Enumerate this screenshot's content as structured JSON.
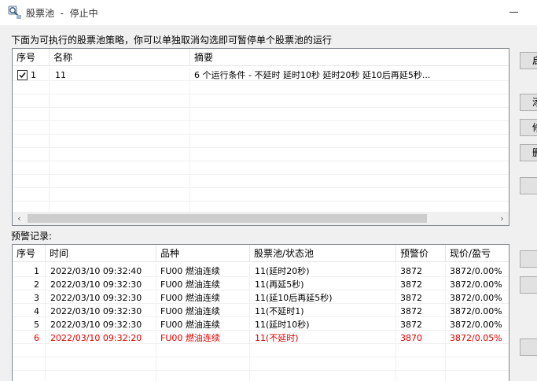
{
  "window": {
    "title": "股票池  -  停止中"
  },
  "instruction": "下面为可执行的股票池策略，你可以单独取消勾选即可暂停单个股票池的运行",
  "strategy_table": {
    "columns": [
      "序号",
      "名称",
      "摘要"
    ],
    "rows": [
      {
        "checked": true,
        "index": "1",
        "name": "11",
        "summary": "6 个运行条件 - 不延时 延时10秒 延时20秒 延10后再延5秒..."
      }
    ]
  },
  "alert_label": "预警记录:",
  "alert_table": {
    "columns": [
      "序号",
      "时间",
      "品种",
      "股票池/状态池",
      "预警价",
      "现价/盈亏"
    ],
    "rows": [
      {
        "index": "1",
        "time": "2022/03/10 09:32:40",
        "symbol": "FU00 燃油连续",
        "pool": "11(延时20秒)",
        "alert_price": "3872",
        "price_pnl": "3872/0.00%",
        "highlight": false
      },
      {
        "index": "2",
        "time": "2022/03/10 09:32:30",
        "symbol": "FU00 燃油连续",
        "pool": "11(再延5秒)",
        "alert_price": "3872",
        "price_pnl": "3872/0.00%",
        "highlight": false
      },
      {
        "index": "3",
        "time": "2022/03/10 09:32:30",
        "symbol": "FU00 燃油连续",
        "pool": "11(延10后再延5秒)",
        "alert_price": "3872",
        "price_pnl": "3872/0.00%",
        "highlight": false
      },
      {
        "index": "4",
        "time": "2022/03/10 09:32:30",
        "symbol": "FU00 燃油连续",
        "pool": "11(不延时1)",
        "alert_price": "3872",
        "price_pnl": "3872/0.00%",
        "highlight": false
      },
      {
        "index": "5",
        "time": "2022/03/10 09:32:30",
        "symbol": "FU00 燃油连续",
        "pool": "11(延时10秒)",
        "alert_price": "3872",
        "price_pnl": "3872/0.00%",
        "highlight": false
      },
      {
        "index": "6",
        "time": "2022/03/10 09:32:20",
        "symbol": "FU00 燃油连续",
        "pool": "11(不延时)",
        "alert_price": "3870",
        "price_pnl": "3872/0.05%",
        "highlight": true
      }
    ]
  },
  "side_buttons": [
    "启",
    "添",
    "修",
    "删",
    "",
    "",
    "",
    ""
  ],
  "colors": {
    "highlight_row": "#e00000",
    "grid_border": "#828790",
    "scroll_thumb": "#cdcdcd"
  },
  "icons": {
    "title": "magnifier-stock-icon",
    "scroll_left": "chevron-left-icon",
    "scroll_right": "chevron-right-icon",
    "checkbox": "checkmark-icon"
  }
}
